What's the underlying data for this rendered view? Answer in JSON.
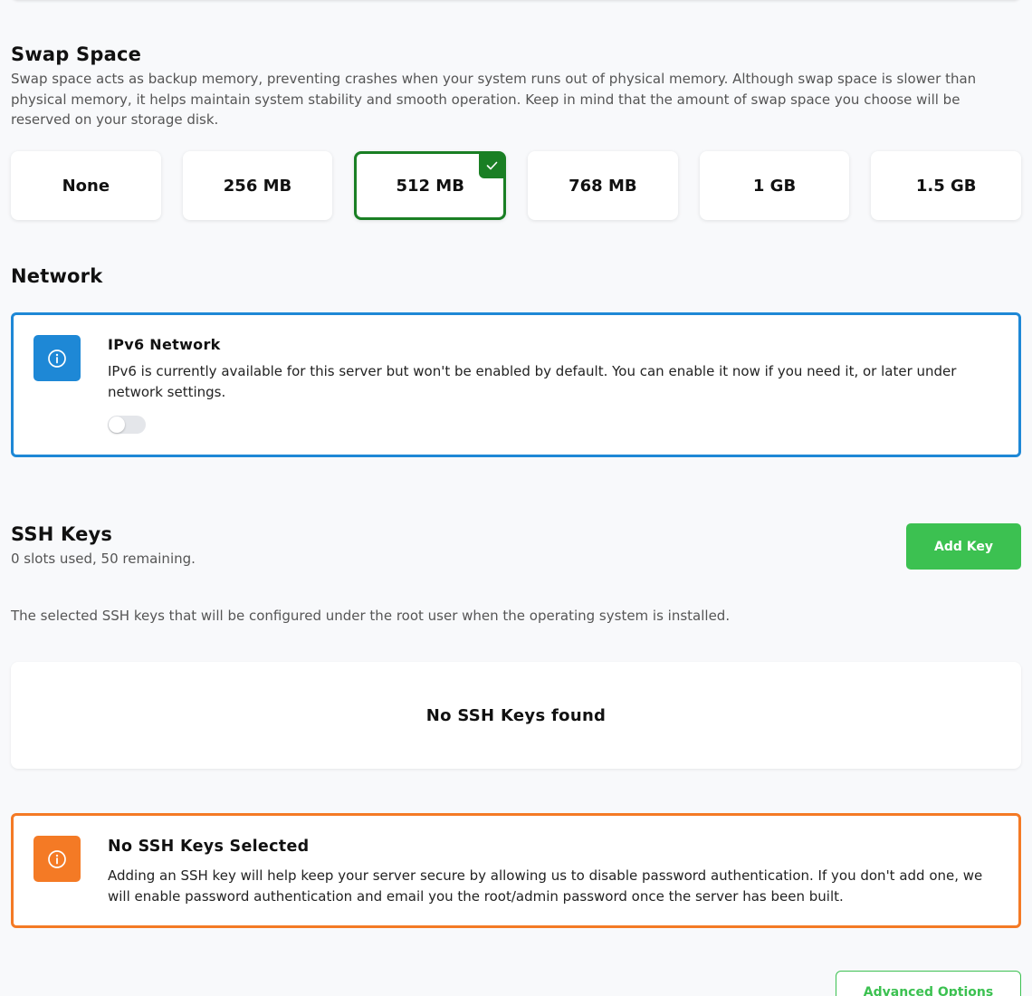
{
  "swap": {
    "title": "Swap Space",
    "description": "Swap space acts as backup memory, preventing crashes when your system runs out of physical memory. Although swap space is slower than physical memory, it helps maintain system stability and smooth operation. Keep in mind that the amount of swap space you choose will be reserved on your storage disk.",
    "options": [
      {
        "label": "None",
        "selected": false
      },
      {
        "label": "256 MB",
        "selected": false
      },
      {
        "label": "512 MB",
        "selected": true
      },
      {
        "label": "768 MB",
        "selected": false
      },
      {
        "label": "1 GB",
        "selected": false
      },
      {
        "label": "1.5 GB",
        "selected": false
      }
    ],
    "selected_color": "#1a7f24"
  },
  "network": {
    "title": "Network",
    "ipv6": {
      "title": "IPv6 Network",
      "text": "IPv6 is currently available for this server but won't be enabled by default. You can enable it now if you need it, or later under network settings.",
      "enabled": false,
      "icon": "info-icon",
      "accent": "#1e88d6"
    }
  },
  "ssh": {
    "title": "SSH Keys",
    "slots": "0 slots used, 50 remaining.",
    "add_label": "Add Key",
    "description": "The selected SSH keys that will be configured under the root user when the operating system is installed.",
    "empty_label": "No SSH Keys found",
    "warning": {
      "title": "No SSH Keys Selected",
      "text": "Adding an SSH key will help keep your server secure by allowing us to disable password authentication. If you don't add one, we will enable password authentication and email you the root/admin password once the server has been built.",
      "icon": "info-icon",
      "accent": "#f47a25"
    }
  },
  "advanced_label": "Advanced Options",
  "brand_green": "#3cc151"
}
